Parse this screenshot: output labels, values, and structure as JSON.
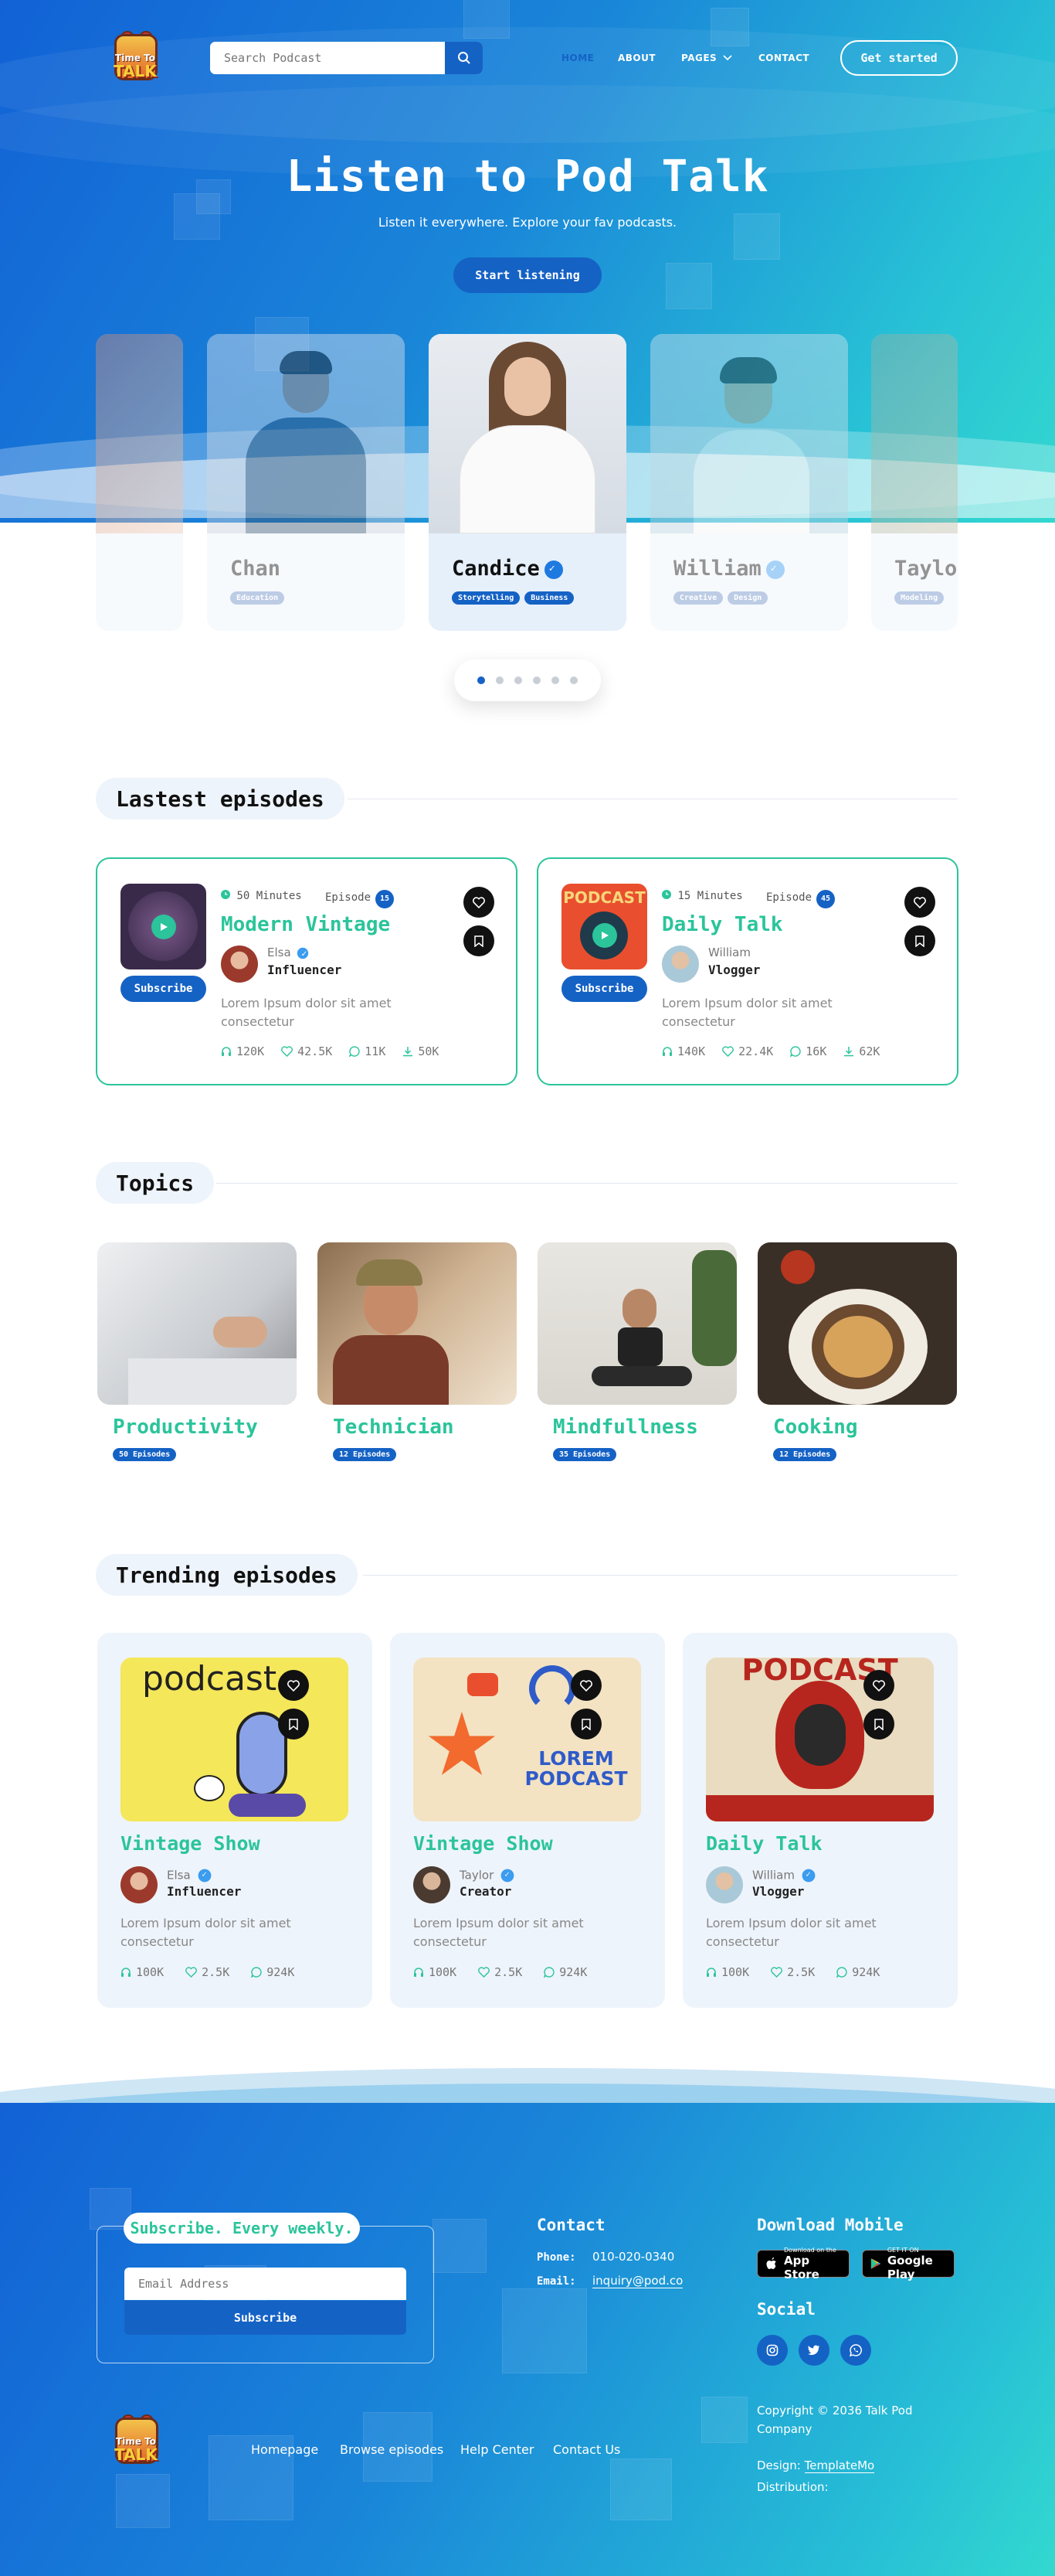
{
  "nav": {
    "search_placeholder": "Search Podcast",
    "links": [
      "HOME",
      "ABOUT",
      "PAGES",
      "CONTACT"
    ],
    "cta": "Get started",
    "logo_line1": "Time To",
    "logo_line2": "TALK"
  },
  "hero": {
    "title": "Listen to Pod Talk",
    "subtitle": "Listen it everywhere. Explore your fav podcasts.",
    "button": "Start listening"
  },
  "profiles": [
    {
      "name": "Chan",
      "tags": [
        "Education"
      ]
    },
    {
      "name": "Candice",
      "tags": [
        "Storytelling",
        "Business"
      ]
    },
    {
      "name": "William",
      "tags": [
        "Creative",
        "Design"
      ]
    },
    {
      "name": "Taylo",
      "tags": [
        "Modeling"
      ]
    }
  ],
  "latest": {
    "heading": "Lastest episodes",
    "items": [
      {
        "duration": "50 Minutes",
        "episode_label": "Episode",
        "episode_no": "15",
        "title": "Modern Vintage",
        "author": "Elsa",
        "role": "Influencer",
        "subscribe": "Subscribe",
        "desc": "Lorem Ipsum dolor sit amet consectetur",
        "listens": "120K",
        "likes": "42.5K",
        "comments": "11K",
        "downloads": "50K"
      },
      {
        "duration": "15 Minutes",
        "episode_label": "Episode",
        "episode_no": "45",
        "title": "Daily Talk",
        "author": "William",
        "role": "Vlogger",
        "subscribe": "Subscribe",
        "desc": "Lorem Ipsum dolor sit amet consectetur",
        "listens": "140K",
        "likes": "22.4K",
        "comments": "16K",
        "downloads": "62K"
      }
    ],
    "art_text": "PODCAST"
  },
  "topics": {
    "heading": "Topics",
    "items": [
      {
        "title": "Productivity",
        "count": "50 Episodes"
      },
      {
        "title": "Technician",
        "count": "12 Episodes"
      },
      {
        "title": "Mindfullness",
        "count": "35 Episodes"
      },
      {
        "title": "Cooking",
        "count": "12 Episodes"
      }
    ]
  },
  "trending": {
    "heading": "Trending episodes",
    "items": [
      {
        "title": "Vintage Show",
        "author": "Elsa",
        "role": "Influencer",
        "desc": "Lorem Ipsum dolor sit amet consectetur",
        "listens": "100K",
        "likes": "2.5K",
        "comments": "924K",
        "art_text": "podcast"
      },
      {
        "title": "Vintage Show",
        "author": "Taylor",
        "role": "Creator",
        "desc": "Lorem Ipsum dolor sit amet consectetur",
        "listens": "100K",
        "likes": "2.5K",
        "comments": "924K",
        "art_text": "LOREM PODCAST"
      },
      {
        "title": "Daily Talk",
        "author": "William",
        "role": "Vlogger",
        "desc": "Lorem Ipsum dolor sit amet consectetur",
        "listens": "100K",
        "likes": "2.5K",
        "comments": "924K",
        "art_text": "PODCAST"
      }
    ]
  },
  "footer": {
    "subscribe_title": "Subscribe. Every weekly.",
    "email_placeholder": "Email Address",
    "subscribe_button": "Subscribe",
    "contact_title": "Contact",
    "phone_label": "Phone:",
    "phone": "010-020-0340",
    "email_label": "Email:",
    "email": "inquiry@pod.co",
    "download_title": "Download Mobile",
    "app_store_small": "Download on the",
    "app_store": "App Store",
    "play_small": "GET IT ON",
    "play": "Google Play",
    "social_title": "Social",
    "links": [
      "Homepage",
      "Browse episodes",
      "Help Center",
      "Contact Us"
    ],
    "copyright": "Copyright © 2036 Talk Pod Company",
    "design_label": "Design:",
    "design": "TemplateMo",
    "distribution_label": "Distribution:"
  },
  "colors": {
    "primary": "#1562c5",
    "accent": "#2bc49b",
    "bg_light": "#eef4fb"
  }
}
